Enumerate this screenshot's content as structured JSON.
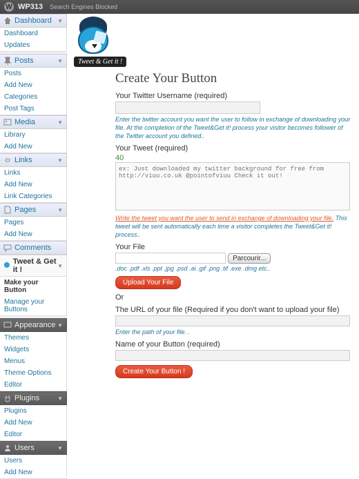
{
  "adminbar": {
    "site": "WP313",
    "seb": "Search Engines Blocked"
  },
  "menu": {
    "dashboard": {
      "label": "Dashboard",
      "items": [
        "Dashboard",
        "Updates"
      ]
    },
    "posts": {
      "label": "Posts",
      "items": [
        "Posts",
        "Add New",
        "Categories",
        "Post Tags"
      ]
    },
    "media": {
      "label": "Media",
      "items": [
        "Library",
        "Add New"
      ]
    },
    "links": {
      "label": "Links",
      "items": [
        "Links",
        "Add New",
        "Link Categories"
      ]
    },
    "pages": {
      "label": "Pages",
      "items": [
        "Pages",
        "Add New"
      ]
    },
    "comments": {
      "label": "Comments"
    },
    "tweet": {
      "label": "Tweet & Get it !",
      "items": [
        "Make your Button",
        "Manage your Buttons"
      ]
    },
    "appearance": {
      "label": "Appearance",
      "items": [
        "Themes",
        "Widgets",
        "Menus",
        "Theme Options",
        "Editor"
      ]
    },
    "plugins": {
      "label": "Plugins",
      "items": [
        "Plugins",
        "Add New",
        "Editor"
      ]
    },
    "users": {
      "label": "Users",
      "items": [
        "Users",
        "Add New"
      ]
    }
  },
  "logo": {
    "badge": "Tweet & Get it !"
  },
  "page": {
    "title": "Create Your Button",
    "username_label": "Your Twitter Username (required)",
    "username_help": "Enter the twitter account you want the user to follow in exchange of downloading your file. At the completion of the Tweet&Get it! process your visitor becomes follower of the Twitter account you defined..",
    "tweet_label": "Your Tweet (required)",
    "tweet_count": "40",
    "tweet_placeholder": "ex: Just downloaded my twitter background for free from http://viuu.co.uk @pointofviuu Check it out!",
    "tweet_help_warn": "Write the tweet you want the user to send in exchange of downloading your file.",
    "tweet_help_rest": " This tweet will be sent automatically each time a visitor completes the Tweet&Get it! process..",
    "file_label": "Your File",
    "browse": "Parcourir...",
    "extensions": ".doc .pdf .xls .ppt .jpg .psd .ai .gif .png .tif .exe .dmg etc..",
    "upload_btn": "Upload Your File",
    "or": "Or",
    "url_label": "The URL of your file (Required if you don't want to upload your file)",
    "url_help": "Enter the path of your file. .",
    "name_label": "Name of your Button (required)",
    "create_btn": "Create Your Button !"
  }
}
